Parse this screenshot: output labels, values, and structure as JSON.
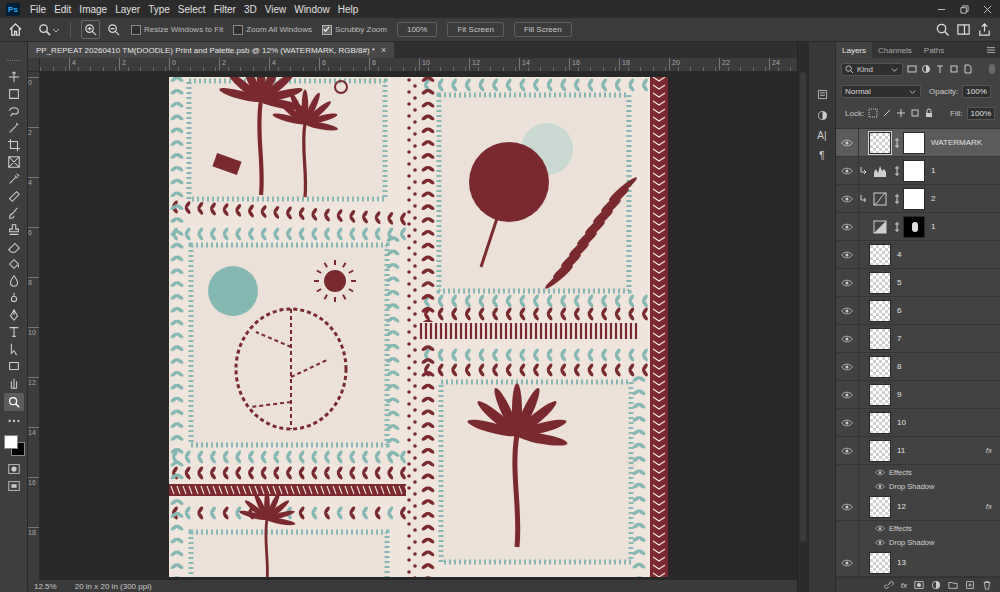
{
  "app": {
    "logo": "Ps"
  },
  "menu": [
    "File",
    "Edit",
    "Image",
    "Layer",
    "Type",
    "Select",
    "Filter",
    "3D",
    "View",
    "Window",
    "Help"
  ],
  "options_bar": {
    "checkboxes": [
      {
        "label": "Resize Windows to Fit",
        "checked": false
      },
      {
        "label": "Zoom All Windows",
        "checked": false
      },
      {
        "label": "Scrubby Zoom",
        "checked": true
      }
    ],
    "buttons": [
      "100%",
      "Fit Screen",
      "Fill Screen"
    ]
  },
  "document": {
    "tab_title": "PP_REPEAT 20260410 TM(DOODLE) Print and Palette.psb @ 12% (WATERMARK, RGB/8#) *",
    "close": "×"
  },
  "rulers": {
    "top": [
      "4",
      "2",
      "0",
      "2",
      "4",
      "6",
      "8",
      "10",
      "12",
      "14",
      "16",
      "18",
      "20",
      "22",
      "24"
    ],
    "left": [
      "0",
      "2",
      "4",
      "6",
      "8",
      "10",
      "12",
      "14",
      "16",
      "18"
    ]
  },
  "status_bar": {
    "zoom": "12.5%",
    "size": "20 in x 20 in (300 ppi)"
  },
  "dock": {
    "glyphs": [
      "A|",
      "¶"
    ]
  },
  "layers_panel": {
    "tabs": [
      {
        "label": "Layers",
        "selected": true
      },
      {
        "label": "Channels",
        "selected": false
      },
      {
        "label": "Paths",
        "selected": false
      }
    ],
    "filter": "Kind",
    "blend_mode": "Normal",
    "opacity_label": "Opacity:",
    "opacity": "100%",
    "lock_label": "Lock:",
    "fill_label": "Fill:",
    "fill": "100%",
    "fx_label": "fx",
    "footer_fx": "fx",
    "layers": [
      {
        "name": "WATERMARK",
        "kind": "pixel",
        "mask": "light",
        "clipped": false,
        "visible": true,
        "selected": true,
        "fx": false,
        "effects": []
      },
      {
        "name": "1",
        "kind": "levels",
        "mask": "light",
        "clipped": true,
        "visible": true,
        "selected": false,
        "fx": false,
        "effects": []
      },
      {
        "name": "2",
        "kind": "curves",
        "mask": "light",
        "clipped": true,
        "visible": true,
        "selected": false,
        "fx": false,
        "effects": []
      },
      {
        "name": "1",
        "kind": "gradient",
        "mask": "dark",
        "clipped": false,
        "visible": true,
        "selected": false,
        "fx": false,
        "effects": []
      },
      {
        "name": "4",
        "kind": "pixel",
        "mask": "none",
        "clipped": false,
        "visible": true,
        "selected": false,
        "fx": false,
        "effects": []
      },
      {
        "name": "5",
        "kind": "pixel",
        "mask": "none",
        "clipped": false,
        "visible": true,
        "selected": false,
        "fx": false,
        "effects": []
      },
      {
        "name": "6",
        "kind": "pixel",
        "mask": "none",
        "clipped": false,
        "visible": true,
        "selected": false,
        "fx": false,
        "effects": []
      },
      {
        "name": "7",
        "kind": "pixel",
        "mask": "none",
        "clipped": false,
        "visible": true,
        "selected": false,
        "fx": false,
        "effects": []
      },
      {
        "name": "8",
        "kind": "pixel",
        "mask": "none",
        "clipped": false,
        "visible": true,
        "selected": false,
        "fx": false,
        "effects": []
      },
      {
        "name": "9",
        "kind": "pixel",
        "mask": "none",
        "clipped": false,
        "visible": true,
        "selected": false,
        "fx": false,
        "effects": []
      },
      {
        "name": "10",
        "kind": "pixel",
        "mask": "none",
        "clipped": false,
        "visible": true,
        "selected": false,
        "fx": false,
        "effects": []
      },
      {
        "name": "11",
        "kind": "pixel",
        "mask": "none",
        "clipped": false,
        "visible": true,
        "selected": false,
        "fx": true,
        "effects_title": "Effects",
        "effects_visible": true,
        "effects": [
          {
            "label": "Drop Shadow",
            "visible": true
          }
        ]
      },
      {
        "name": "12",
        "kind": "pixel",
        "mask": "none",
        "clipped": false,
        "visible": true,
        "selected": false,
        "fx": true,
        "effects_title": "Effects",
        "effects_visible": true,
        "effects": [
          {
            "label": "Drop Shadow",
            "visible": true
          }
        ]
      },
      {
        "name": "13",
        "kind": "pixel",
        "mask": "none",
        "clipped": false,
        "visible": true,
        "selected": false,
        "fx": false,
        "effects": []
      }
    ]
  }
}
